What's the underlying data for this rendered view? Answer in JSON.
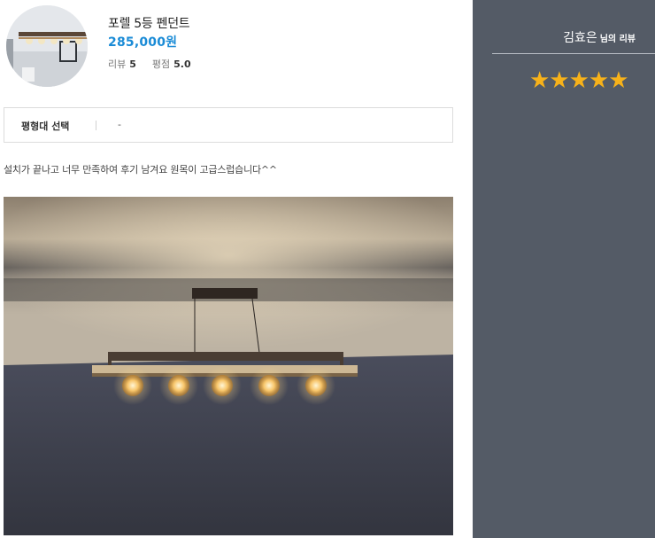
{
  "product": {
    "name": "포렐 5등 펜던트",
    "price": "285,000원",
    "review_label": "리뷰",
    "review_count": "5",
    "rating_label": "평점",
    "rating_value": "5.0"
  },
  "option": {
    "label": "평형대 선택",
    "value": "-"
  },
  "review": {
    "text": "설치가 끝나고 너무 만족하여 후기 남겨요 원목이 고급스럽습니다^^"
  },
  "reviewer": {
    "name": "김효은",
    "suffix": "님의 리뷰",
    "stars": "★★★★★",
    "rating": 5
  },
  "colors": {
    "price": "#1a8bd6",
    "sidebar_bg": "#545b66",
    "star": "#f7b21a"
  }
}
